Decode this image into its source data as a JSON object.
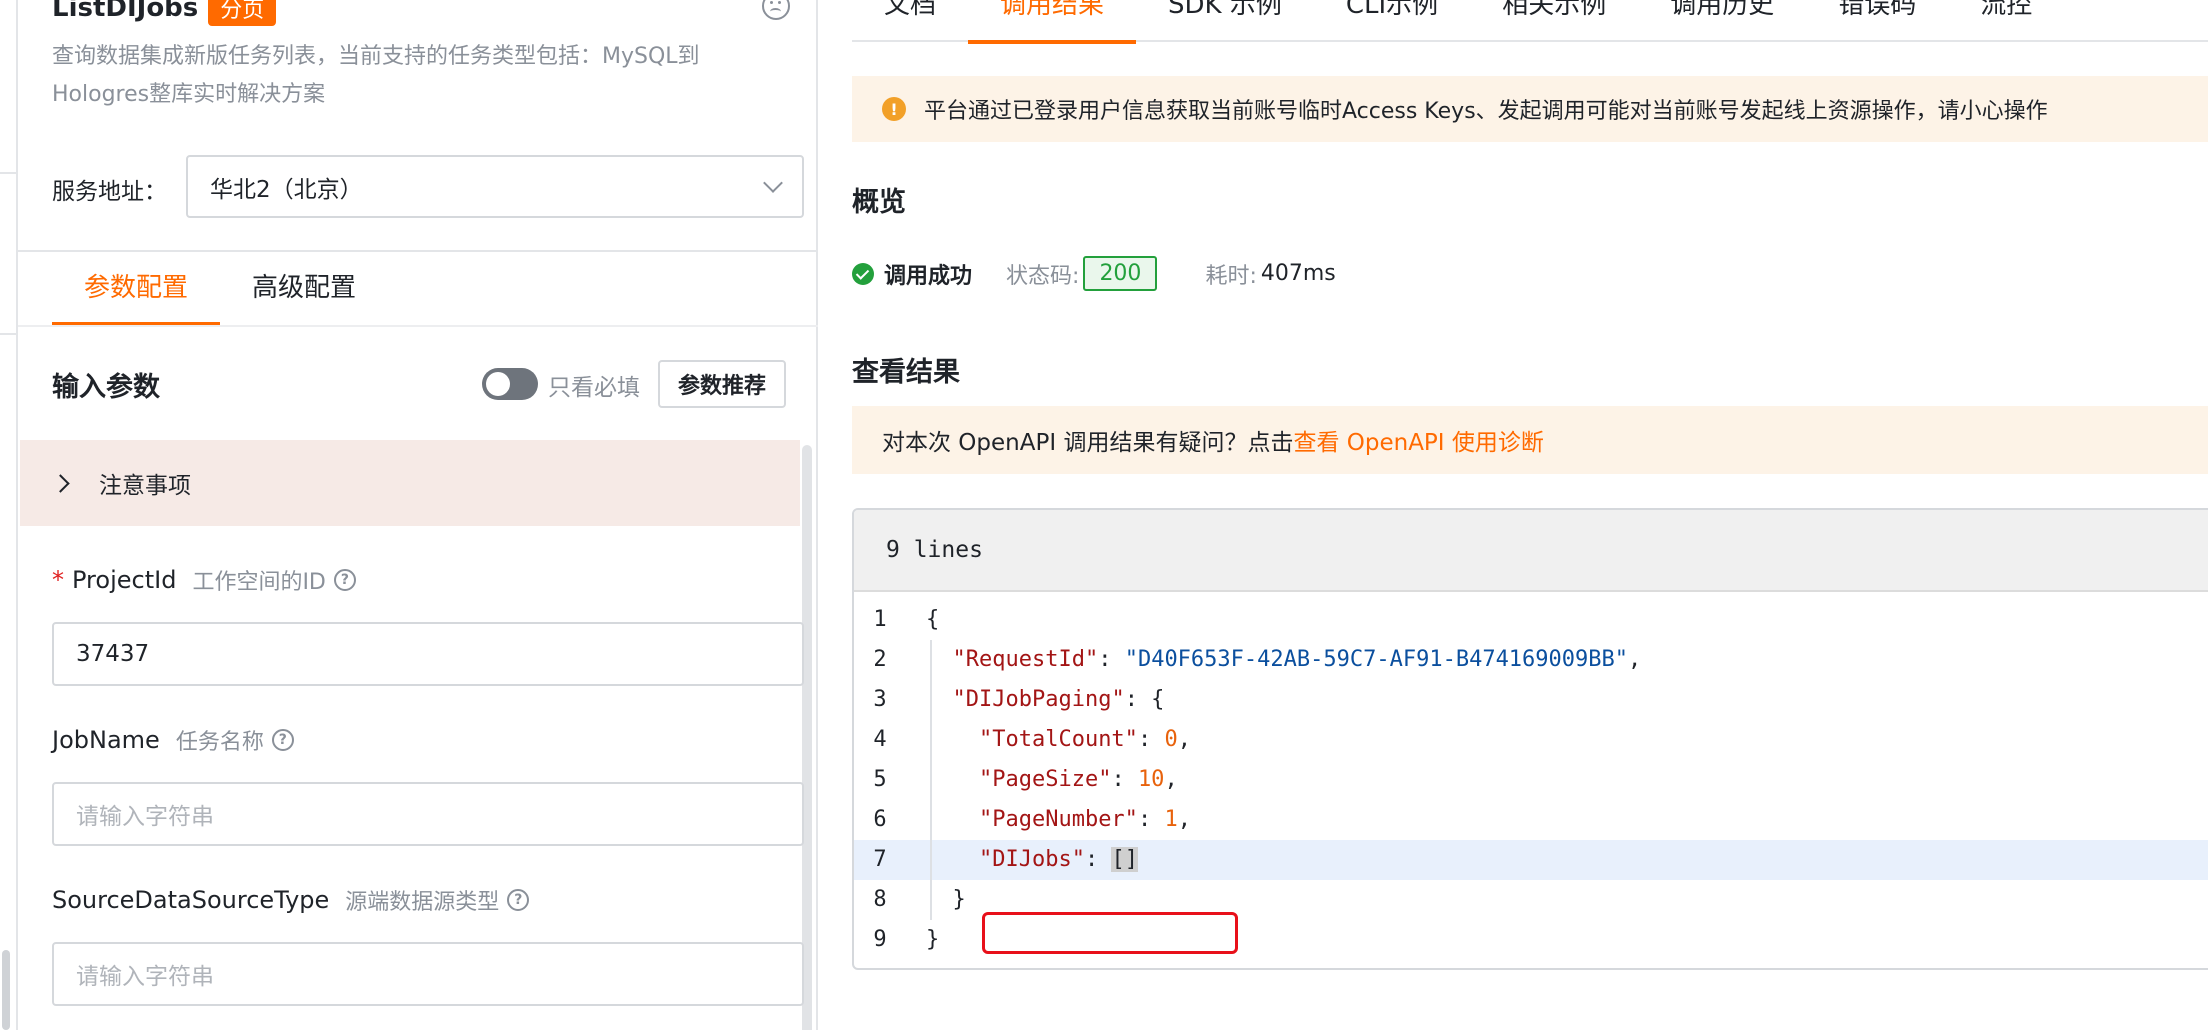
{
  "left": {
    "api_name": "ListDIJobs",
    "api_badge": "分页",
    "description": "查询数据集成新版任务列表，当前支持的任务类型包括：MySQL到Hologres整库实时解决方案",
    "region_label": "服务地址：",
    "region_value": "华北2（北京）",
    "tabs": [
      {
        "label": "参数配置"
      },
      {
        "label": "高级配置"
      }
    ],
    "input_params_title": "输入参数",
    "toggle_label": "只看必填",
    "recommend_button": "参数推荐",
    "notice_label": "注意事项",
    "fields": [
      {
        "name": "ProjectId",
        "desc": "工作空间的ID",
        "required": "*",
        "value": "37437"
      },
      {
        "name": "JobName",
        "desc": "任务名称",
        "placeholder": "请输入字符串"
      },
      {
        "name": "SourceDataSourceType",
        "desc": "源端数据源类型",
        "placeholder": "请输入字符串"
      }
    ]
  },
  "right": {
    "tabs": [
      {
        "label": "文档"
      },
      {
        "label": "调用结果"
      },
      {
        "label": "SDK 示例"
      },
      {
        "label": "CLI示例"
      },
      {
        "label": "相关示例"
      },
      {
        "label": "调用历史"
      },
      {
        "label": "错误码"
      },
      {
        "label": "流控"
      }
    ],
    "warning": "平台通过已登录用户信息获取当前账号临时Access Keys、发起调用可能对当前账号发起线上资源操作，请小心操作",
    "overview_title": "概览",
    "status_ok": "调用成功",
    "status_code_label": "状态码:",
    "status_code": "200",
    "duration_label": "耗时:",
    "duration_value": "407ms",
    "result_title": "查看结果",
    "diag_text": "对本次 OpenAPI 调用结果有疑问？点击",
    "diag_link": "查看 OpenAPI 使用诊断",
    "code_header": "9 lines",
    "code": {
      "l1": "{",
      "request_id_key": "\"RequestId\"",
      "request_id_val": "\"D40F653F-42AB-59C7-AF91-B474169009BB\"",
      "paging_key": "\"DIJobPaging\"",
      "total_key": "\"TotalCount\"",
      "total_val": "0",
      "size_key": "\"PageSize\"",
      "size_val": "10",
      "number_key": "\"PageNumber\"",
      "number_val": "1",
      "jobs_key": "\"DIJobs\"",
      "jobs_val": "[]",
      "l8": "}",
      "l9": "}"
    }
  },
  "colors": {
    "accent": "#ff6a00",
    "success": "#23a03c",
    "highlight_box": "#e8101a"
  }
}
